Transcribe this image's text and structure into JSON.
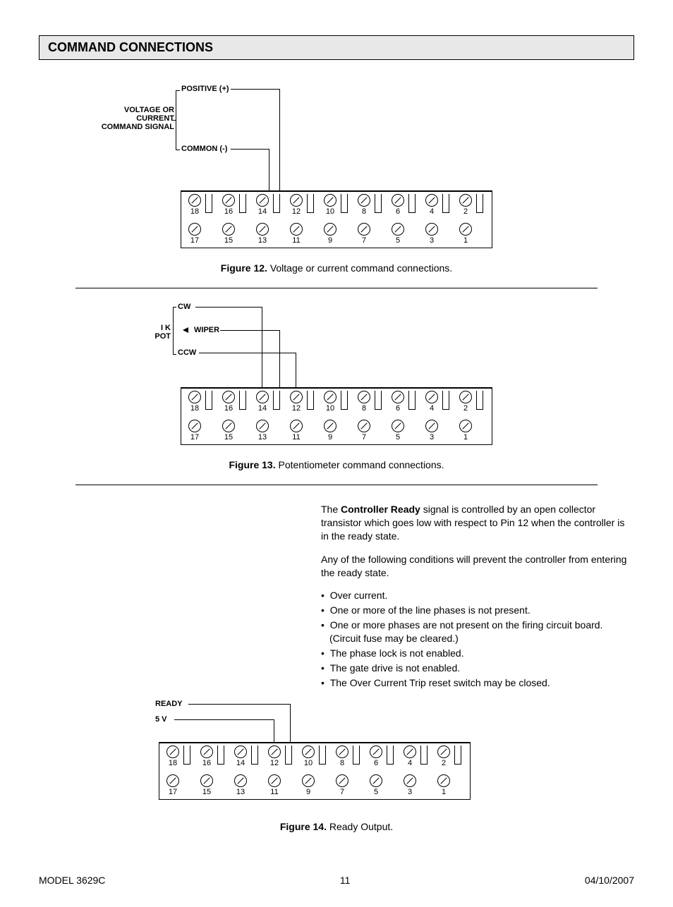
{
  "section_title": "COMMAND CONNECTIONS",
  "fig12": {
    "label_positive": "POSITIVE (+)",
    "label_common": "COMMON (-)",
    "label_signal_l1": "VOLTAGE  OR",
    "label_signal_l2": "CURRENT",
    "label_signal_l3": "COMMAND SIGNAL",
    "caption_bold": "Figure 12.",
    "caption_rest": "  Voltage or current command connections."
  },
  "fig13": {
    "label_cw": "CW",
    "label_wiper": "WIPER",
    "label_ccw": "CCW",
    "label_pot_l1": "I K",
    "label_pot_l2": "POT",
    "caption_bold": "Figure 13.",
    "caption_rest": "  Potentiometer command connections."
  },
  "body": {
    "p1_pre": "The ",
    "p1_bold": "Controller Ready",
    "p1_post": " signal is controlled by an open collector transistor which goes low with respect to Pin 12 when the controller is in the ready state.",
    "p2": "Any of the following conditions will prevent the controller from entering the ready state.",
    "bullets": [
      "Over current.",
      "One or more of the line phases is not present.",
      "One or more phases are not present on the firing circuit board. (Circuit fuse may be cleared.)",
      "The phase lock is not enabled.",
      "The gate drive is not enabled.",
      "The Over Current Trip reset switch may be closed."
    ]
  },
  "fig14": {
    "label_ready": "READY",
    "label_5v": "5 V",
    "caption_bold": "Figure 14.",
    "caption_rest": "  Ready Output."
  },
  "terminals_top": [
    "18",
    "16",
    "14",
    "12",
    "10",
    "8",
    "6",
    "4",
    "2"
  ],
  "terminals_bot": [
    "17",
    "15",
    "13",
    "11",
    "9",
    "7",
    "5",
    "3",
    "1"
  ],
  "footer": {
    "left": "MODEL 3629C",
    "center": "11",
    "right": "04/10/2007"
  }
}
